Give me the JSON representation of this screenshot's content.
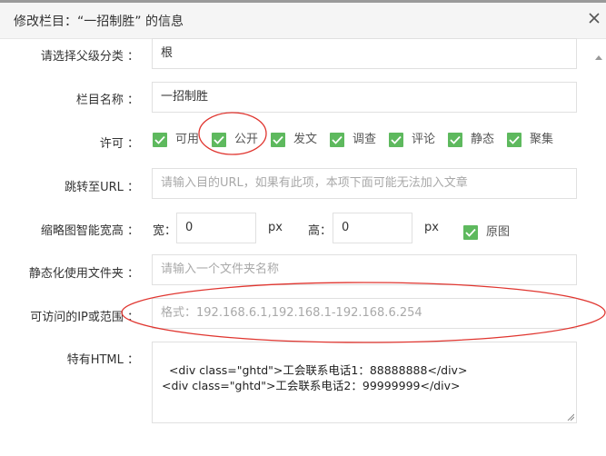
{
  "dialog": {
    "title": "修改栏目：“一招制胜” 的信息"
  },
  "form": {
    "parent": {
      "label": "请选择父级分类 ：",
      "value": "根"
    },
    "name": {
      "label": "栏目名称 ：",
      "value": "一招制胜"
    },
    "permissions": {
      "label": "许可 ：",
      "items": [
        {
          "label": "可用",
          "checked": true
        },
        {
          "label": "公开",
          "checked": true
        },
        {
          "label": "发文",
          "checked": true
        },
        {
          "label": "调查",
          "checked": true
        },
        {
          "label": "评论",
          "checked": true
        },
        {
          "label": "静态",
          "checked": true
        },
        {
          "label": "聚集",
          "checked": true
        }
      ]
    },
    "redirect": {
      "label": "跳转至URL ：",
      "placeholder": "请输入目的URL，如果有此项，本项下面可能无法加入文章"
    },
    "thumbnail": {
      "label": "缩略图智能宽高 ：",
      "width_label": "宽：",
      "width_value": "0",
      "width_unit": "px",
      "height_label": "高：",
      "height_value": "0",
      "height_unit": "px",
      "original_label": "原图",
      "original_checked": true
    },
    "static_folder": {
      "label": "静态化使用文件夹 ：",
      "placeholder": "请输入一个文件夹名称"
    },
    "ip_range": {
      "label": "可访问的IP或范围 ：",
      "placeholder": "格式：192.168.6.1,192.168.1-192.168.6.254"
    },
    "custom_html": {
      "label": "特有HTML ：",
      "value": "<div class=\"ghtd\">工会联系电话1：88888888</div>\n<div class=\"ghtd\">工会联系电话2：99999999</div>"
    }
  },
  "colors": {
    "checkbox": "#5eb95e",
    "annotation": "#e0352f"
  }
}
